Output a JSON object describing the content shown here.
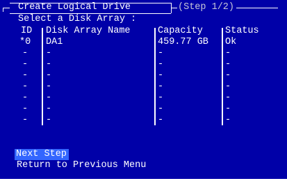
{
  "dialog": {
    "title": "Create Logical Drive",
    "step": "(Step 1/2)",
    "prompt": "Select a Disk Array :"
  },
  "table": {
    "headers": {
      "id": "ID",
      "name": "Disk Array Name",
      "capacity": "Capacity",
      "status": "Status"
    },
    "rows": [
      {
        "id": "*0",
        "name": "DA1",
        "capacity": "459.77 GB",
        "status": "Ok"
      },
      {
        "id": "-",
        "name": "-",
        "capacity": "-",
        "status": "-"
      },
      {
        "id": "-",
        "name": "-",
        "capacity": "-",
        "status": "-"
      },
      {
        "id": "-",
        "name": "-",
        "capacity": "-",
        "status": "-"
      },
      {
        "id": "-",
        "name": "-",
        "capacity": "-",
        "status": "-"
      },
      {
        "id": "-",
        "name": "-",
        "capacity": "-",
        "status": "-"
      },
      {
        "id": "-",
        "name": "-",
        "capacity": "-",
        "status": "-"
      },
      {
        "id": "-",
        "name": "-",
        "capacity": "-",
        "status": "-"
      }
    ]
  },
  "menu": {
    "next_step": "Next Step",
    "return": "Return to Previous Menu"
  },
  "colors": {
    "background": "#0000a8",
    "text": "#ffffff",
    "selection": "#3366ff"
  }
}
